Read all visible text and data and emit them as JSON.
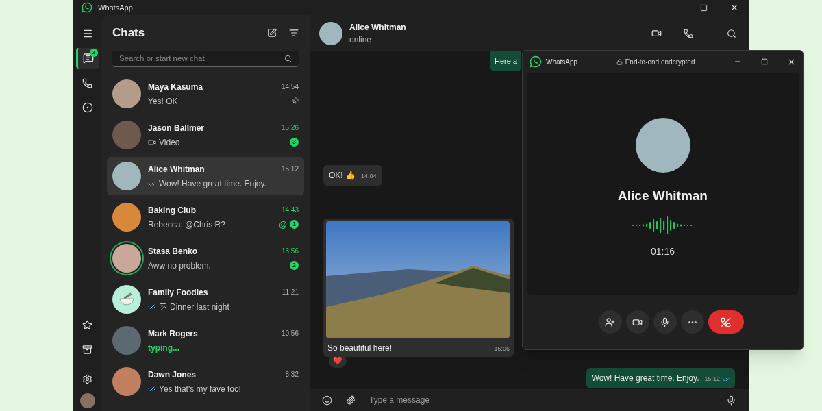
{
  "window": {
    "title": "WhatsApp"
  },
  "rail": {
    "top": [
      {
        "kind": "menu",
        "selected": false
      },
      {
        "kind": "chats",
        "selected": true,
        "badge": "3"
      },
      {
        "kind": "calls",
        "selected": false
      },
      {
        "kind": "status",
        "selected": false
      }
    ],
    "bottom": [
      {
        "kind": "starred",
        "selected": false
      },
      {
        "kind": "archive",
        "selected": false
      },
      {
        "kind": "settings",
        "selected": false
      },
      {
        "kind": "profile",
        "selected": false
      }
    ]
  },
  "chat_list": {
    "title": "Chats",
    "search": {
      "placeholder": "Search or start new chat"
    },
    "chats": [
      {
        "kind": "photo",
        "name": "Maya Kasuma",
        "preview": "Yes! OK",
        "time": "14:54",
        "selected": false,
        "pinned": true,
        "read": false,
        "video": false,
        "image": false,
        "typing": false,
        "status_ring": false
      },
      {
        "kind": "photo",
        "name": "Jason Ballmer",
        "preview": "Video",
        "time": "15:26",
        "unread": "3",
        "selected": false,
        "pinned": false,
        "read": false,
        "video": true,
        "image": false,
        "typing": false,
        "status_ring": false
      },
      {
        "kind": "photo",
        "name": "Alice Whitman",
        "preview": "Wow! Have great time. Enjoy.",
        "time": "15:12",
        "selected": true,
        "pinned": false,
        "read": true,
        "video": false,
        "image": false,
        "typing": false,
        "status_ring": false
      },
      {
        "kind": "photo",
        "name": "Baking Club",
        "preview": "Rebecca: @Chris R?",
        "time": "14:43",
        "unread": "1",
        "mention": "@",
        "selected": false,
        "pinned": false,
        "read": false,
        "video": false,
        "image": false,
        "typing": false,
        "status_ring": false
      },
      {
        "kind": "photo",
        "name": "Stasa Benko",
        "preview": "Aww no problem.",
        "time": "13:56",
        "unread": "2",
        "selected": false,
        "pinned": false,
        "read": false,
        "video": false,
        "image": false,
        "typing": false,
        "status_ring": true
      },
      {
        "kind": "bowl",
        "name": "Family Foodies",
        "preview": "Dinner last night",
        "time": "11:21",
        "selected": false,
        "pinned": false,
        "read": true,
        "video": false,
        "image": true,
        "typing": false,
        "status_ring": false
      },
      {
        "kind": "photo",
        "name": "Mark Rogers",
        "preview": "typing...",
        "time": "10:56",
        "selected": false,
        "pinned": false,
        "read": false,
        "video": false,
        "image": false,
        "typing": true,
        "status_ring": false
      },
      {
        "kind": "photo",
        "name": "Dawn Jones",
        "preview": "Yes that's my fave too!",
        "time": "8:32",
        "selected": false,
        "pinned": false,
        "read": true,
        "video": false,
        "image": false,
        "typing": false,
        "status_ring": false
      }
    ]
  },
  "conversation": {
    "name": "Alice Whitman",
    "status": "online",
    "messages": [
      {
        "kind": "text",
        "outgoing": true,
        "text": "Here a",
        "read": false
      },
      {
        "kind": "text",
        "outgoing": false,
        "text": "OK! 👍",
        "time": "14:04",
        "read": false
      },
      {
        "kind": "image",
        "outgoing": false,
        "text": "So beautiful here!",
        "time": "15:06",
        "reaction": "❤️",
        "read": false
      },
      {
        "kind": "text",
        "outgoing": true,
        "text": "Wow! Have great time. Enjoy.",
        "time": "15:12",
        "read": true
      }
    ],
    "composer": {
      "placeholder": "Type a message"
    }
  },
  "call": {
    "title": "WhatsApp",
    "encryption": "End-to-end endcrypted",
    "name": "Alice Whitman",
    "duration": "01:16",
    "controls": [
      {
        "kind": "add-person"
      },
      {
        "kind": "video"
      },
      {
        "kind": "mic"
      },
      {
        "kind": "more"
      },
      {
        "kind": "hang-up"
      }
    ]
  }
}
